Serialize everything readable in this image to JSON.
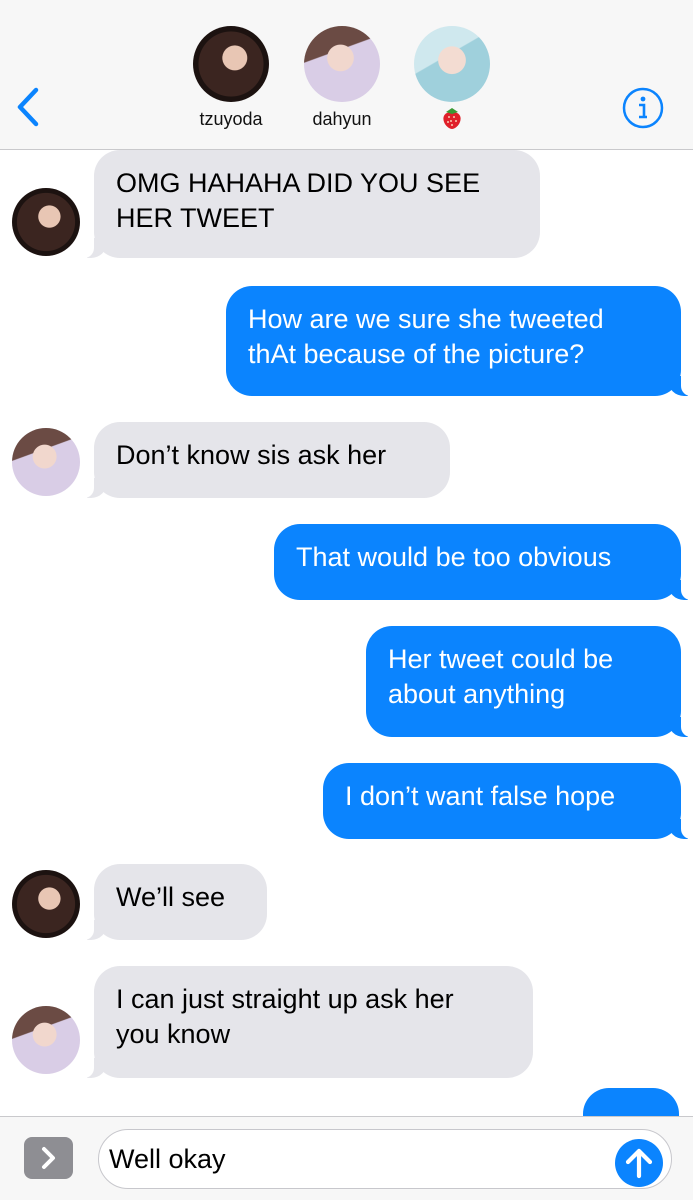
{
  "header": {
    "contacts": [
      {
        "name": "tzuyoda",
        "avatar": "tzuyoda-avatar"
      },
      {
        "name": "dahyun",
        "avatar": "dahyun-avatar"
      },
      {
        "name": "",
        "avatar": "contact-3-avatar",
        "emoji": "strawberry-icon"
      }
    ],
    "back_icon": "chevron-left-icon",
    "info_icon": "info-icon"
  },
  "messages": [
    {
      "from": "tzuyoda",
      "direction": "in",
      "text": "OMG HAHAHA DID YOU SEE\nHER TWEET"
    },
    {
      "from": "me",
      "direction": "out",
      "text": "How are we sure she tweeted\nthAt because of the picture?"
    },
    {
      "from": "dahyun",
      "direction": "in",
      "text": "Don’t know sis ask her"
    },
    {
      "from": "me",
      "direction": "out",
      "text": "That would be too obvious"
    },
    {
      "from": "me",
      "direction": "out",
      "text": "Her tweet could be\nabout anything"
    },
    {
      "from": "me",
      "direction": "out",
      "text": "I don’t want false hope"
    },
    {
      "from": "tzuyoda",
      "direction": "in",
      "text": "We’ll see"
    },
    {
      "from": "dahyun",
      "direction": "in",
      "text": "I can just straight up ask her\nyou know"
    }
  ],
  "compose": {
    "value": "Well okay",
    "expand_icon": "chevron-right-icon",
    "send_icon": "arrow-up-icon"
  },
  "colors": {
    "accent": "#0b84fe",
    "incoming_bubble": "#e5e5ea",
    "header_bg": "#f7f7f7"
  }
}
